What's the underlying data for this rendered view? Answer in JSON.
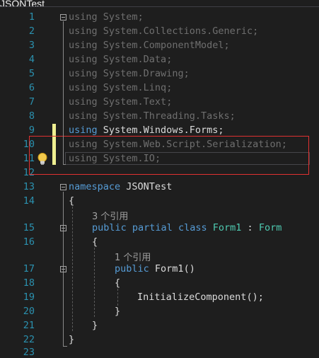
{
  "tab": {
    "title": "JSONTest"
  },
  "lines": [
    {
      "n": "1"
    },
    {
      "n": "2"
    },
    {
      "n": "3"
    },
    {
      "n": "4"
    },
    {
      "n": "5"
    },
    {
      "n": "6"
    },
    {
      "n": "7"
    },
    {
      "n": "8"
    },
    {
      "n": "9"
    },
    {
      "n": "10"
    },
    {
      "n": "11"
    },
    {
      "n": "12"
    },
    {
      "n": "13"
    },
    {
      "n": "14"
    },
    {
      "n": "15"
    },
    {
      "n": "16"
    },
    {
      "n": "17"
    },
    {
      "n": "18"
    },
    {
      "n": "19"
    },
    {
      "n": "20"
    },
    {
      "n": "21"
    },
    {
      "n": "22"
    },
    {
      "n": "23"
    }
  ],
  "code": {
    "kw_using": "using",
    "u1": "System",
    "u2": "System.Collections.Generic",
    "u3": "System.ComponentModel",
    "u4": "System.Data",
    "u5": "System.Drawing",
    "u6": "System.Linq",
    "u7": "System.Text",
    "u8": "System.Threading.Tasks",
    "u9": "System.Windows.Forms",
    "u10": "System.Web.Script.Serialization",
    "u11": "System.IO",
    "semicolon": ";",
    "kw_namespace": "namespace",
    "ns_name": "JSONTest",
    "open_brace": "{",
    "close_brace": "}",
    "codelens_3": "3 个引用",
    "kw_public": "public",
    "kw_partial": "partial",
    "kw_class": "class",
    "class_name": "Form1",
    "colon": ":",
    "base_class": "Form",
    "codelens_1": "1 个引用",
    "ctor_name": "Form1",
    "ctor_parens": "()",
    "call_name": "InitializeComponent",
    "call_tail": "();"
  },
  "colors": {
    "background": "#1e1e1e",
    "line_number": "#2b91af",
    "keyword": "#569cd6",
    "type": "#4ec9b0",
    "highlight_box": "#e03131",
    "change_bar": "#efef91"
  },
  "icons": {
    "lightbulb": "lightbulb-icon"
  }
}
